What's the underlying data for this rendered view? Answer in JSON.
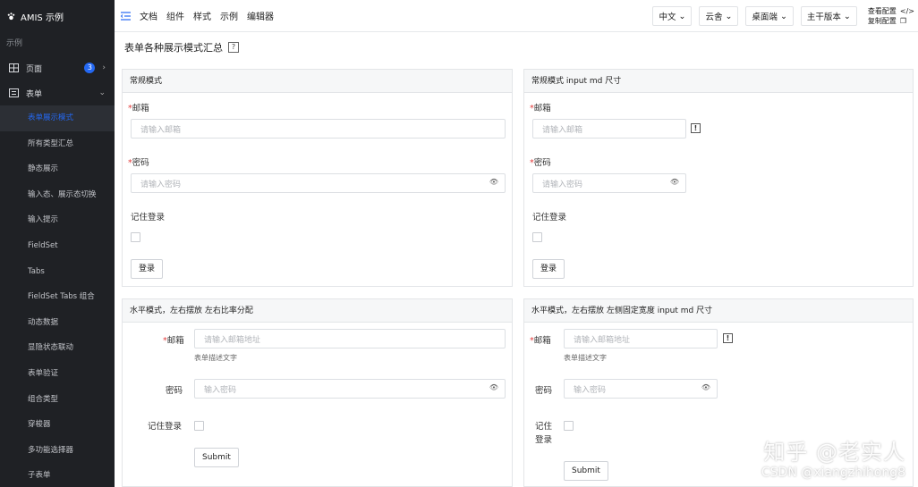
{
  "app": {
    "title": "AMIS 示例"
  },
  "sidebar": {
    "section": "示例",
    "groups": [
      {
        "label": "页面",
        "badge": "3",
        "chevron": ">",
        "icon": "grid-icon"
      },
      {
        "label": "表单",
        "chevron": "v",
        "icon": "form-icon"
      }
    ],
    "items": [
      {
        "label": "表单展示模式",
        "active": true
      },
      {
        "label": "所有类型汇总"
      },
      {
        "label": "静态展示"
      },
      {
        "label": "输入态、展示态切换"
      },
      {
        "label": "输入提示"
      },
      {
        "label": "FieldSet"
      },
      {
        "label": "Tabs"
      },
      {
        "label": "FieldSet Tabs 组合"
      },
      {
        "label": "动态数据"
      },
      {
        "label": "显隐状态联动"
      },
      {
        "label": "表单验证"
      },
      {
        "label": "组合类型"
      },
      {
        "label": "穿梭器"
      },
      {
        "label": "多功能选择器"
      },
      {
        "label": "子表单"
      }
    ]
  },
  "topbar": {
    "links": [
      "文档",
      "组件",
      "样式",
      "示例",
      "编辑器"
    ],
    "dropdowns": [
      "中文",
      "云舍",
      "桌面端",
      "主干版本"
    ],
    "right_links": [
      "查看配置",
      "复制配置"
    ]
  },
  "page": {
    "title": "表单各种展示模式汇总",
    "help": "?"
  },
  "panels": {
    "normal": {
      "title": "常规模式",
      "email_label": "邮箱",
      "email_placeholder": "请输入邮箱",
      "password_label": "密码",
      "password_placeholder": "请输入密码",
      "remember_label": "记住登录",
      "submit_label": "登录"
    },
    "normal_md": {
      "title": "常规模式 input md 尺寸",
      "email_label": "邮箱",
      "email_placeholder": "请输入邮箱",
      "password_label": "密码",
      "password_placeholder": "请输入密码",
      "remember_label": "记住登录",
      "submit_label": "登录"
    },
    "horizontal": {
      "title": "水平模式，左右摆放 左右比率分配",
      "email_label": "邮箱",
      "email_placeholder": "请输入邮箱地址",
      "email_desc": "表单描述文字",
      "password_label": "密码",
      "password_placeholder": "输入密码",
      "remember_label": "记住登录",
      "submit_label": "Submit"
    },
    "horizontal_fixed": {
      "title": "水平模式，左右摆放 左侧固定宽度 input md 尺寸",
      "email_label": "邮箱",
      "email_placeholder": "请输入邮箱地址",
      "email_desc": "表单描述文字",
      "password_label": "密码",
      "password_placeholder": "输入密码",
      "remember_label_1": "记住",
      "remember_label_2": "登录",
      "submit_label": "Submit"
    }
  },
  "watermark": {
    "line1": "知乎 @老实人",
    "line2": "CSDN @xiangzhihong8"
  },
  "colors": {
    "sidebar_bg": "#1f2125",
    "accent": "#2468f2",
    "required": "#e23b3b"
  }
}
